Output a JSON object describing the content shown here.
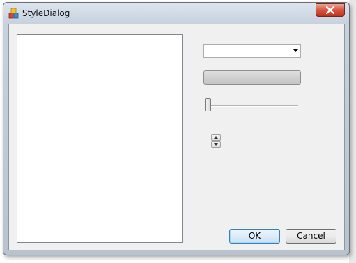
{
  "window": {
    "title": "StyleDialog",
    "app_icon": "app-icon",
    "close_icon": "close-icon"
  },
  "controls": {
    "style_combo": {
      "value": ""
    },
    "wide_button": {
      "label": ""
    },
    "slider": {
      "value": 0
    },
    "spinner": {
      "up_icon": "arrow-up-icon",
      "down_icon": "arrow-down-icon"
    }
  },
  "buttons": {
    "ok_label": "OK",
    "cancel_label": "Cancel"
  },
  "colors": {
    "close_red": "#c0321a",
    "ok_border": "#3c7fb1"
  }
}
